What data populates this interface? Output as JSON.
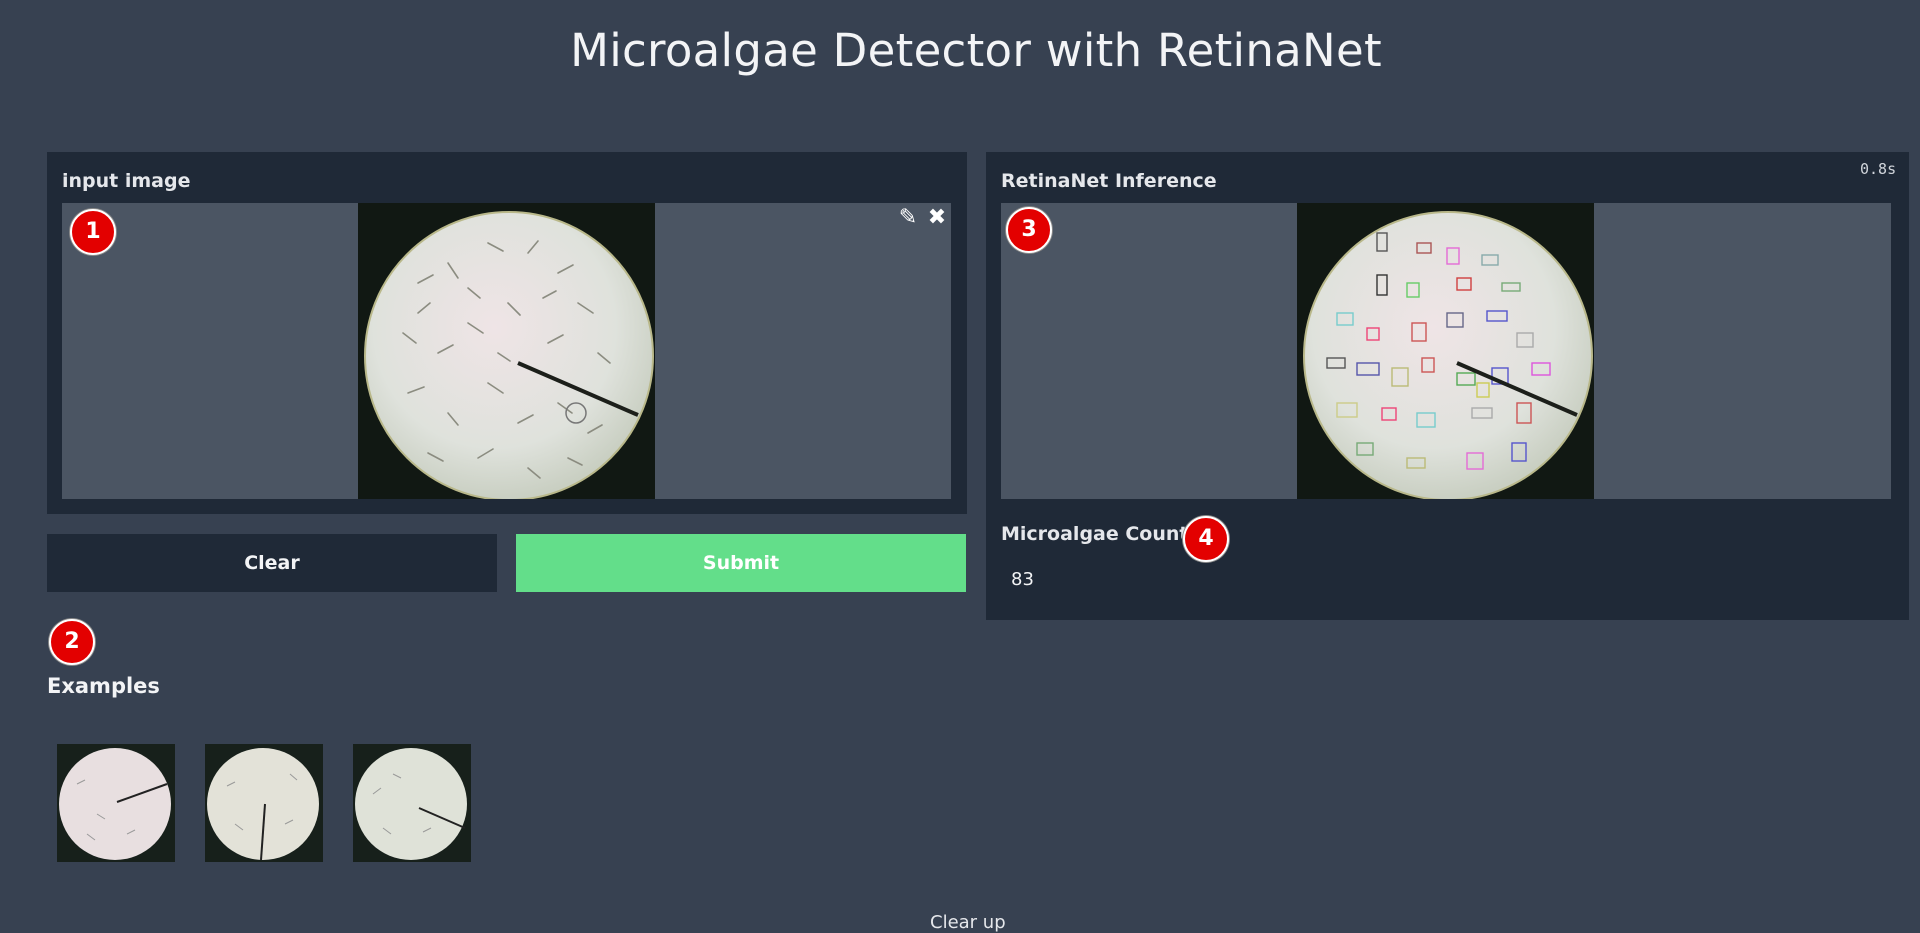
{
  "page": {
    "title": "Microalgae Detector with RetinaNet"
  },
  "input_panel": {
    "label": "input image",
    "marker": "1",
    "edit_icon": "pencil-icon",
    "close_icon": "close-icon",
    "edit_glyph": "✎",
    "close_glyph": "✖"
  },
  "buttons": {
    "clear_label": "Clear",
    "submit_label": "Submit"
  },
  "examples": {
    "marker": "2",
    "label": "Examples",
    "items": [
      "example-1",
      "example-2",
      "example-3"
    ]
  },
  "output_panel": {
    "label": "RetinaNet Inference",
    "time": "0.8s",
    "marker": "3",
    "count_label": "Microalgae Count",
    "count_marker": "4",
    "count_value": "83"
  },
  "footer": {
    "text": "Clear up"
  },
  "colors": {
    "background": "#374151",
    "panel": "#1f2937",
    "image_area": "#4b5563",
    "submit": "#63de8a",
    "marker": "#e30000"
  }
}
